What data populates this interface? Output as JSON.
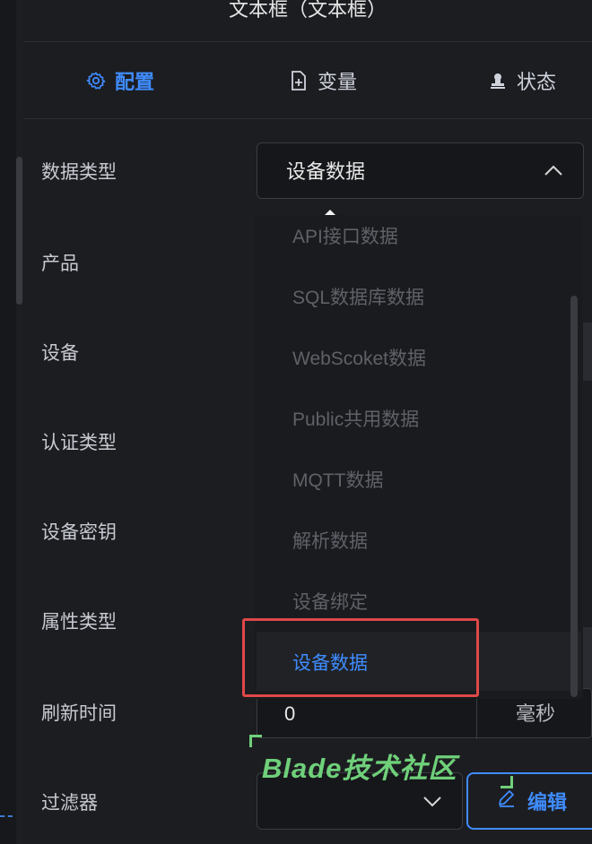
{
  "panel": {
    "title": "文本框（文本框）"
  },
  "tabs": [
    {
      "label": "配置",
      "icon": "gear-icon",
      "active": true
    },
    {
      "label": "变量",
      "icon": "add-file-icon",
      "active": false
    },
    {
      "label": "状态",
      "icon": "stamp-icon",
      "active": false
    }
  ],
  "form": {
    "labels": {
      "data_type": "数据类型",
      "product": "产品",
      "device": "设备",
      "auth_type": "认证类型",
      "device_key": "设备密钥",
      "attr_type": "属性类型",
      "refresh_time": "刷新时间",
      "filter": "过滤器"
    },
    "data_type_value": "设备数据",
    "refresh_value": "0",
    "refresh_unit": "毫秒",
    "edit_label": "编辑"
  },
  "dropdown": {
    "options": [
      "API接口数据",
      "SQL数据库数据",
      "WebScoket数据",
      "Public共用数据",
      "MQTT数据",
      "解析数据",
      "设备绑定",
      "设备数据"
    ],
    "selected_index": 7
  },
  "watermark": {
    "text": "Blade技术社区"
  },
  "colors": {
    "accent": "#3f8cff",
    "highlight": "#e04848",
    "watermark": "#6fd07a"
  }
}
